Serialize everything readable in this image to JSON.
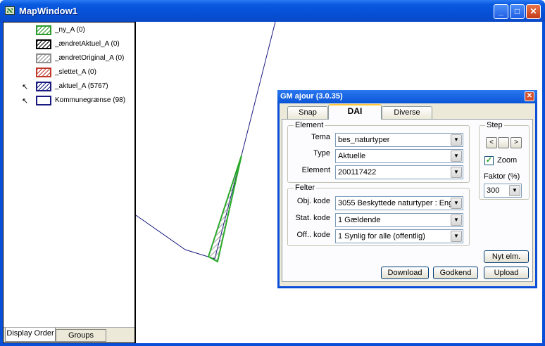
{
  "window": {
    "title": "MapWindow1"
  },
  "legend": {
    "layers": [
      {
        "label": "_ny_A (0)",
        "color": "#2a9a2a",
        "pattern": "hatch",
        "pointer": false
      },
      {
        "label": "_ændretAktuel_A (0)",
        "color": "#000000",
        "pattern": "hatch",
        "pointer": false
      },
      {
        "label": "_ændretOriginal_A (0)",
        "color": "#909090",
        "pattern": "hatch",
        "pointer": false
      },
      {
        "label": "_slettet_A (0)",
        "color": "#c0392b",
        "pattern": "hatch",
        "pointer": false
      },
      {
        "label": "_aktuel_A (5767)",
        "color": "#1a1a80",
        "pattern": "hatch",
        "pointer": true
      },
      {
        "label": "Kommunegrænse (98)",
        "color": "#1a1a80",
        "pattern": "empty",
        "pointer": true
      }
    ],
    "tabs": [
      "Display Order",
      "Groups"
    ]
  },
  "dialog": {
    "title": "GM ajour (3.0.35)",
    "tabs": [
      "Snap",
      "DAI",
      "Diverse"
    ],
    "active_tab": "DAI",
    "element": {
      "label": "Element",
      "tema_label": "Tema",
      "tema_value": "bes_naturtyper",
      "type_label": "Type",
      "type_value": "Aktuelle",
      "element_label": "Element",
      "element_value": "200117422"
    },
    "felter": {
      "label": "Felter",
      "obj_label": "Obj. kode",
      "obj_value": "3055 Beskyttede naturtyper : Eng",
      "stat_label": "Stat. kode",
      "stat_value": "1 Gældende",
      "off_label": "Off.. kode",
      "off_value": "1 Synlig for alle (offentlig)"
    },
    "step": {
      "label": "Step",
      "zoom_label": "Zoom",
      "zoom_checked": true,
      "faktor_label": "Faktor (%)",
      "faktor_value": "300"
    },
    "buttons": {
      "nyt": "Nyt elm.",
      "download": "Download",
      "godkend": "Godkend",
      "upload": "Upload"
    }
  }
}
